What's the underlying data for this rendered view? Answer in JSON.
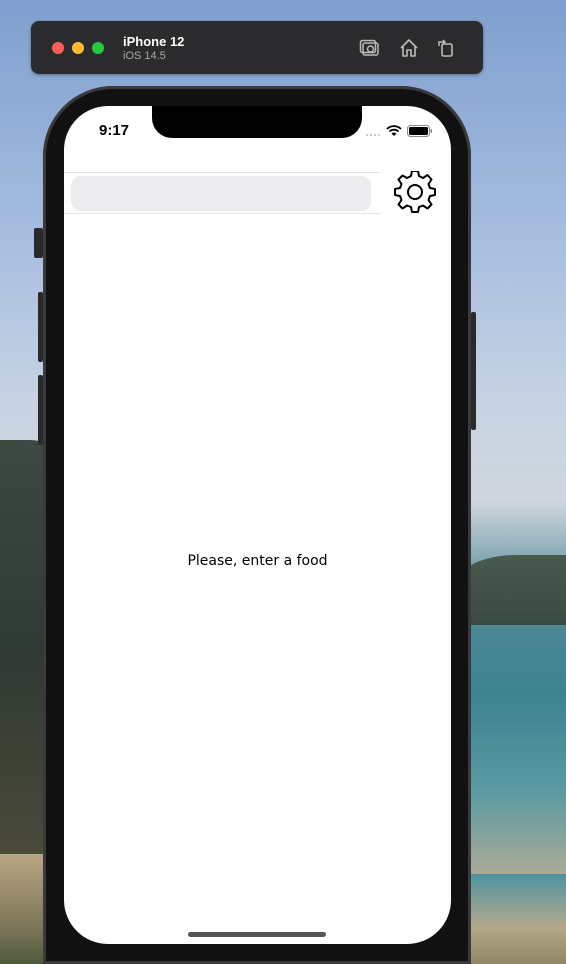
{
  "simulator": {
    "device_name": "iPhone 12",
    "os_version": "iOS 14.5",
    "toolbar_icons": [
      "screenshot-icon",
      "home-icon",
      "rotate-icon"
    ]
  },
  "status_bar": {
    "time": "9:17",
    "icons": [
      "cellular-icon",
      "wifi-icon",
      "battery-icon"
    ]
  },
  "search": {
    "value": "",
    "placeholder": ""
  },
  "settings": {
    "icon": "gear-icon"
  },
  "main": {
    "empty_message": "Please, enter a food"
  },
  "colors": {
    "traffic_red": "#ff5f57",
    "traffic_yellow": "#febc2e",
    "traffic_green": "#28c840",
    "search_bg": "#ececee"
  }
}
